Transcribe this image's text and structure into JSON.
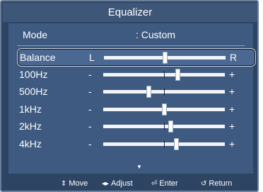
{
  "title": "Equalizer",
  "mode": {
    "label": "Mode",
    "value": ": Custom"
  },
  "rows": [
    {
      "name": "Balance",
      "left": "L",
      "right": "R",
      "level": 0.5,
      "selected": true
    },
    {
      "name": "100Hz",
      "left": "-",
      "right": "+",
      "level": 0.61,
      "selected": false
    },
    {
      "name": "500Hz",
      "left": "-",
      "right": "+",
      "level": 0.37,
      "selected": false
    },
    {
      "name": "1kHz",
      "left": "-",
      "right": "+",
      "level": 0.5,
      "selected": false
    },
    {
      "name": "2kHz",
      "left": "-",
      "right": "+",
      "level": 0.55,
      "selected": false
    },
    {
      "name": "4kHz",
      "left": "-",
      "right": "+",
      "level": 0.6,
      "selected": false
    }
  ],
  "more_indicator": "▼",
  "nav": {
    "move": {
      "icon": "⇕",
      "label": "Move"
    },
    "adjust": {
      "icon": "◂▸",
      "label": "Adjust"
    },
    "enter": {
      "icon": "⏎",
      "label": "Enter"
    },
    "return": {
      "icon": "↺",
      "label": "Return"
    }
  }
}
